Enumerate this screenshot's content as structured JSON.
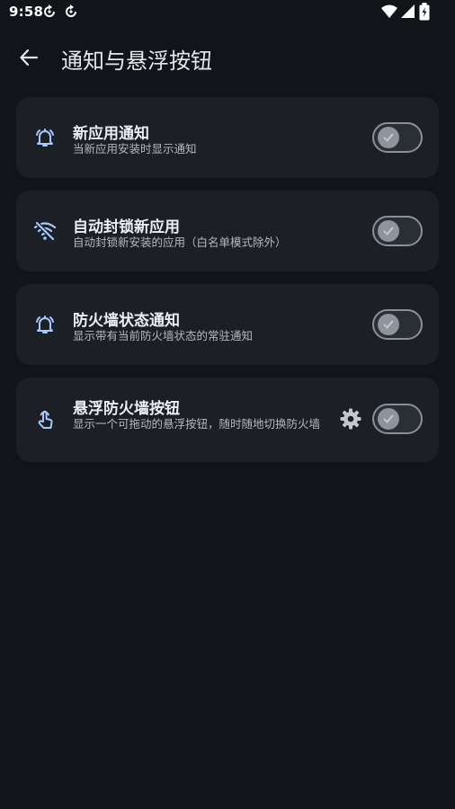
{
  "status_bar": {
    "time": "9:58"
  },
  "header": {
    "title": "通知与悬浮按钮"
  },
  "settings": [
    {
      "title": "新应用通知",
      "subtitle": "当新应用安装时显示通知",
      "icon": "bell-ring-icon",
      "enabled": false
    },
    {
      "title": "自动封锁新应用",
      "subtitle": "自动封锁新安装的应用（白名单模式除外）",
      "icon": "wifi-off-icon",
      "enabled": false
    },
    {
      "title": "防火墙状态通知",
      "subtitle": "显示带有当前防火墙状态的常驻通知",
      "icon": "bell-ring-icon",
      "enabled": false
    },
    {
      "title": "悬浮防火墙按钮",
      "subtitle": "显示一个可拖动的悬浮按钮，随时随地切换防火墙",
      "icon": "touch-icon",
      "enabled": false
    }
  ],
  "colors": {
    "background": "#111419",
    "card": "#1c2026",
    "icon_accent": "#a8c7fa",
    "toggle_border": "#8b8f97"
  }
}
